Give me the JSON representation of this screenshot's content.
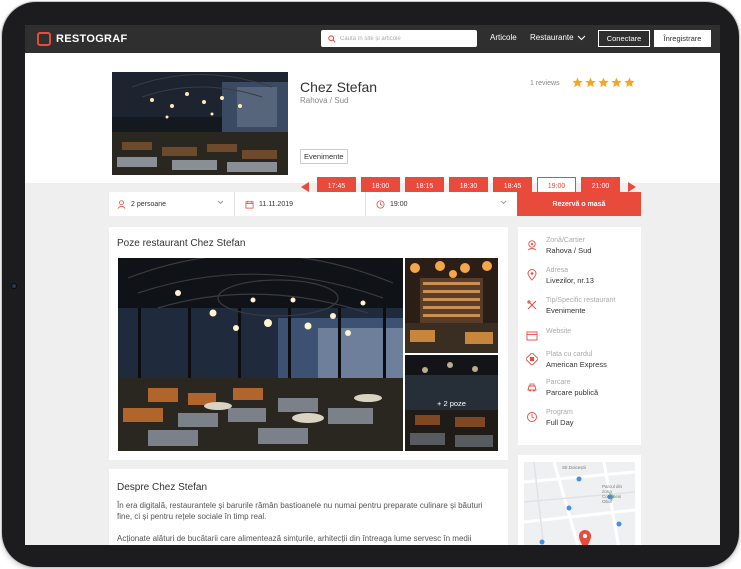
{
  "nav": {
    "logo": "RESTOGRAF",
    "search_placeholder": "Caută în site și articole",
    "articole": "Articole",
    "restaurante": "Restaurante",
    "conectare": "Conectare",
    "inregistrare": "Înregistrare"
  },
  "restaurant": {
    "name": "Chez Stefan",
    "location": "Rahova / Sud",
    "reviews": "1 reviews",
    "rating": 5,
    "tag": "Evenimente"
  },
  "time_slots": [
    {
      "label": "17:45",
      "selected": false
    },
    {
      "label": "18:00",
      "selected": false
    },
    {
      "label": "18:15",
      "selected": false
    },
    {
      "label": "18:30",
      "selected": false
    },
    {
      "label": "18:45",
      "selected": false
    },
    {
      "label": "19:00",
      "selected": true
    },
    {
      "label": "21:00",
      "selected": false
    }
  ],
  "booking": {
    "persons": "2 persoane",
    "date": "11.11.2019",
    "time": "19:00",
    "submit": "Rezervă o masă"
  },
  "photos": {
    "title": "Poze restaurant Chez Stefan",
    "more": "+ 2 poze"
  },
  "info": [
    {
      "icon": "map-pin-icon",
      "label": "Zonă/Cartier",
      "value": "Rahova / Sud"
    },
    {
      "icon": "location-icon",
      "label": "Adresa",
      "value": "Livezilor, nr.13"
    },
    {
      "icon": "cutlery-icon",
      "label": "Tip/Specific restaurant",
      "value": "Evenimente"
    },
    {
      "icon": "website-icon",
      "label": "Website",
      "value": ""
    },
    {
      "icon": "card-icon",
      "label": "Plata cu cardul",
      "value": "American Express"
    },
    {
      "icon": "parking-icon",
      "label": "Parcare",
      "value": "Parcare publică"
    },
    {
      "icon": "clock-icon",
      "label": "Program",
      "value": "Full Day"
    }
  ],
  "about": {
    "title": "Despre Chez Stefan",
    "p1": "În era digitală, restaurantele și barurile rămân bastioanele nu numai pentru preparate culinare și băuturi fine, ci și pentru rețele sociale în timp real.",
    "p2": "Acționate alături de bucătarii care alimentează simțurile, arhitecții din întreaga lume servesc în medii"
  },
  "map": {
    "street_label": "Str.Doiceștii",
    "poi_label": "Parcul din zona Cotroceni Obor"
  },
  "colors": {
    "accent": "#e84a3c",
    "topbar": "#2f2f2f",
    "star": "#f5a623"
  }
}
